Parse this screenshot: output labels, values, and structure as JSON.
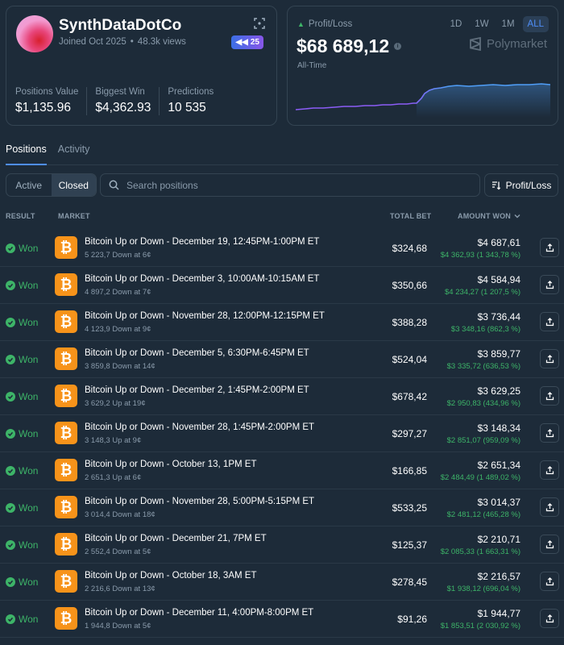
{
  "profile": {
    "username": "SynthDataDotCo",
    "joined": "Joined Oct 2025",
    "views": "48.3k views",
    "badge_value": "25",
    "stats": [
      {
        "label": "Positions Value",
        "value": "$1,135.96"
      },
      {
        "label": "Biggest Win",
        "value": "$4,362.93"
      },
      {
        "label": "Predictions",
        "value": "10 535"
      }
    ]
  },
  "pnl": {
    "label": "Profit/Loss",
    "value": "$68 689,12",
    "period": "All-Time",
    "brand": "Polymarket",
    "ranges": [
      "1D",
      "1W",
      "1M",
      "ALL"
    ],
    "active_range": "ALL",
    "colors": {
      "line_start": "#8b5cf6",
      "line_end": "#4f9ef7",
      "up_arrow": "#3db468"
    }
  },
  "tabs": [
    {
      "label": "Positions",
      "active": true
    },
    {
      "label": "Activity",
      "active": false
    }
  ],
  "filters": {
    "status": [
      {
        "label": "Active",
        "active": false
      },
      {
        "label": "Closed",
        "active": true
      }
    ],
    "search_placeholder": "Search positions",
    "sort_label": "Profit/Loss"
  },
  "table": {
    "headers": {
      "result": "RESULT",
      "market": "MARKET",
      "total_bet": "TOTAL BET",
      "amount_won": "AMOUNT WON"
    },
    "rows": [
      {
        "result": "Won",
        "title": "Bitcoin Up or Down - December 19, 12:45PM-1:00PM ET",
        "sub": "5 223,7 Down at 6¢",
        "total_bet": "$324,68",
        "amount": "$4 687,61",
        "gain": "$4 362,93 (1 343,78 %)"
      },
      {
        "result": "Won",
        "title": "Bitcoin Up or Down - December 3, 10:00AM-10:15AM ET",
        "sub": "4 897,2 Down at 7¢",
        "total_bet": "$350,66",
        "amount": "$4 584,94",
        "gain": "$4 234,27 (1 207,5 %)"
      },
      {
        "result": "Won",
        "title": "Bitcoin Up or Down - November 28, 12:00PM-12:15PM ET",
        "sub": "4 123,9 Down at 9¢",
        "total_bet": "$388,28",
        "amount": "$3 736,44",
        "gain": "$3 348,16 (862,3 %)"
      },
      {
        "result": "Won",
        "title": "Bitcoin Up or Down - December 5, 6:30PM-6:45PM ET",
        "sub": "3 859,8 Down at 14¢",
        "total_bet": "$524,04",
        "amount": "$3 859,77",
        "gain": "$3 335,72 (636,53 %)"
      },
      {
        "result": "Won",
        "title": "Bitcoin Up or Down - December 2, 1:45PM-2:00PM ET",
        "sub": "3 629,2 Up at 19¢",
        "total_bet": "$678,42",
        "amount": "$3 629,25",
        "gain": "$2 950,83 (434,96 %)"
      },
      {
        "result": "Won",
        "title": "Bitcoin Up or Down - November 28, 1:45PM-2:00PM ET",
        "sub": "3 148,3 Up at 9¢",
        "total_bet": "$297,27",
        "amount": "$3 148,34",
        "gain": "$2 851,07 (959,09 %)"
      },
      {
        "result": "Won",
        "title": "Bitcoin Up or Down - October 13, 1PM ET",
        "sub": "2 651,3 Up at 6¢",
        "total_bet": "$166,85",
        "amount": "$2 651,34",
        "gain": "$2 484,49 (1 489,02 %)"
      },
      {
        "result": "Won",
        "title": "Bitcoin Up or Down - November 28, 5:00PM-5:15PM ET",
        "sub": "3 014,4 Down at 18¢",
        "total_bet": "$533,25",
        "amount": "$3 014,37",
        "gain": "$2 481,12 (465,28 %)"
      },
      {
        "result": "Won",
        "title": "Bitcoin Up or Down - December 21, 7PM ET",
        "sub": "2 552,4 Down at 5¢",
        "total_bet": "$125,37",
        "amount": "$2 210,71",
        "gain": "$2 085,33 (1 663,31 %)"
      },
      {
        "result": "Won",
        "title": "Bitcoin Up or Down - October 18, 3AM ET",
        "sub": "2 216,6 Down at 13¢",
        "total_bet": "$278,45",
        "amount": "$2 216,57",
        "gain": "$1 938,12 (696,04 %)"
      },
      {
        "result": "Won",
        "title": "Bitcoin Up or Down - December 11, 4:00PM-8:00PM ET",
        "sub": "1 944,8 Down at 5¢",
        "total_bet": "$91,26",
        "amount": "$1 944,77",
        "gain": "$1 853,51 (2 030,92 %)"
      }
    ]
  }
}
